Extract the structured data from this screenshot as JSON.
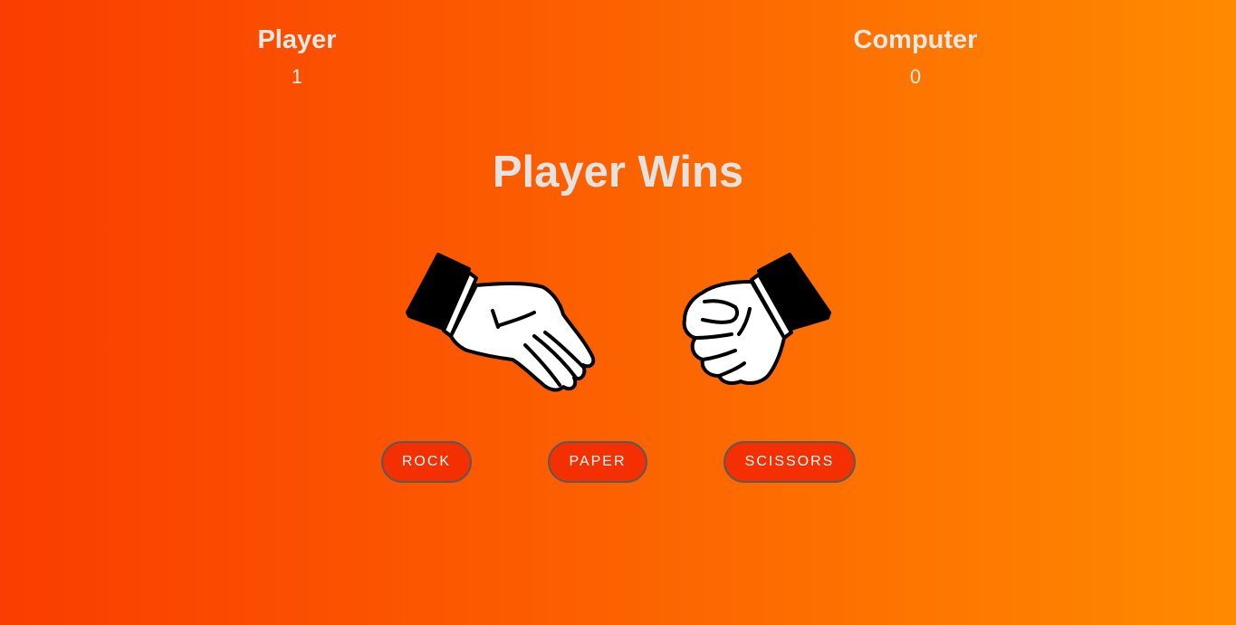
{
  "scoreboard": {
    "player_label": "Player",
    "player_score": "1",
    "computer_label": "Computer",
    "computer_score": "0"
  },
  "result_text": "Player Wins",
  "hands": {
    "player_choice_icon": "paper-hand-icon",
    "computer_choice_icon": "rock-fist-icon"
  },
  "buttons": {
    "rock": "ROCK",
    "paper": "PAPER",
    "scissors": "SCISSORS"
  },
  "colors": {
    "background_start": "#fa3d00",
    "background_end": "#ff8a00",
    "button_bg": "#f42f00",
    "text": "#e9e6e4"
  }
}
